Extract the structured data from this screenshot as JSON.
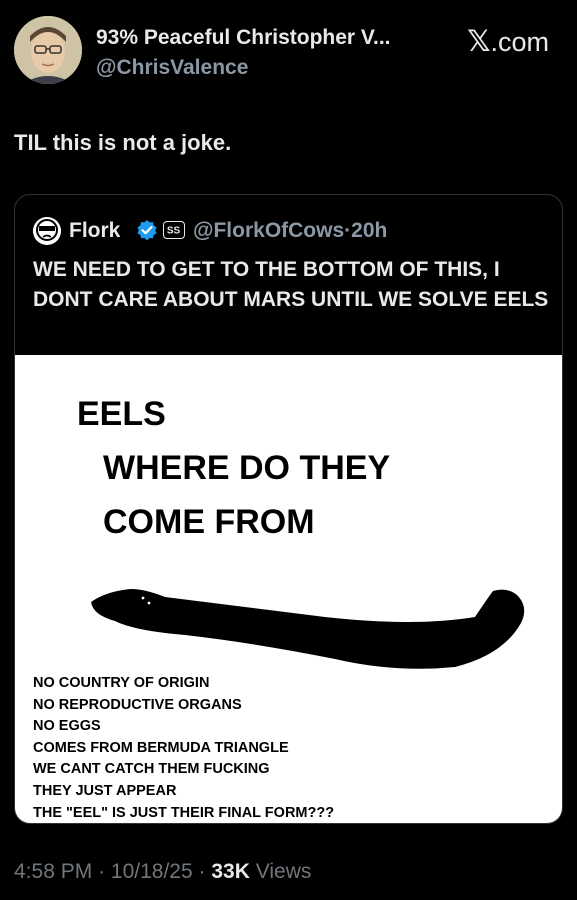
{
  "author": {
    "display_name": "93% Peaceful Christopher V...",
    "handle": "@ChrisValence"
  },
  "brand": {
    "mark": "𝕏",
    "text": ".com"
  },
  "tweet": {
    "text": "TIL this is not a joke."
  },
  "quote": {
    "name": "Flork",
    "handle": "@FlorkOfCows",
    "separator": "·",
    "age": "20h",
    "text": "WE NEED TO GET TO THE BOTTOM OF THIS, I DONT CARE ABOUT MARS UNTIL WE SOLVE EELS",
    "verified_color": "#1d9bf0",
    "badges": [
      "verified-badge-icon",
      "affiliate-badge-icon"
    ]
  },
  "meme": {
    "line1": "EELS",
    "line2": "WHERE DO THEY",
    "line3": "COME FROM",
    "list": [
      "NO COUNTRY OF ORIGIN",
      "NO REPRODUCTIVE ORGANS",
      "NO EGGS",
      "COMES FROM BERMUDA TRIANGLE",
      "WE CANT CATCH THEM FUCKING",
      "THEY JUST APPEAR",
      "THE \"EEL\" IS JUST THEIR FINAL FORM???"
    ]
  },
  "footer": {
    "time": "4:58 PM",
    "date": "10/18/25",
    "views_count": "33K",
    "views_label": "Views",
    "dot": "·"
  }
}
